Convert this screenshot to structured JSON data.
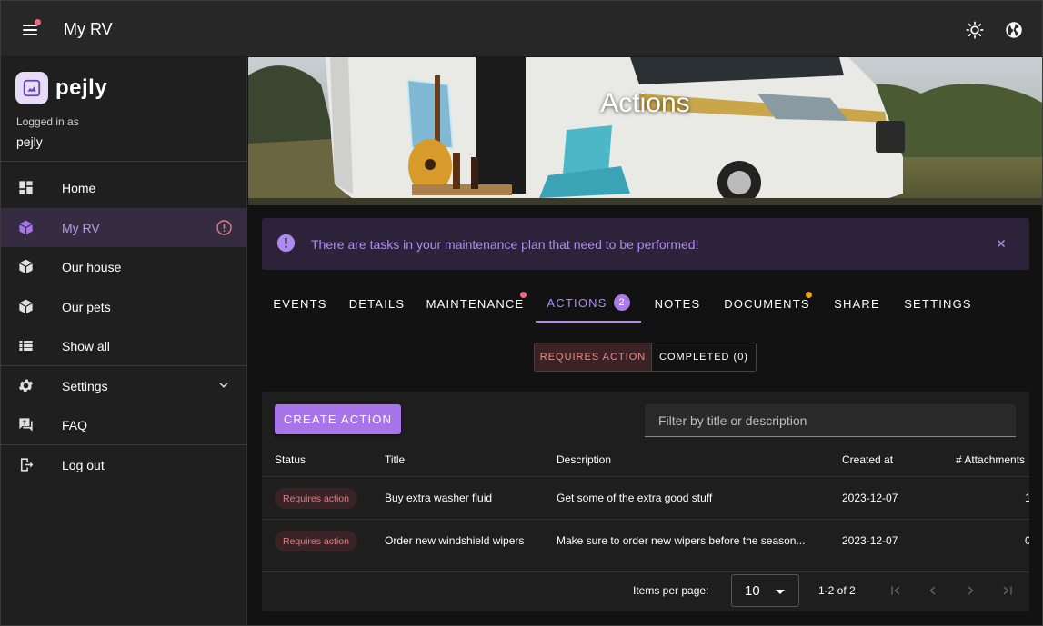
{
  "app": {
    "title": "My RV"
  },
  "brand": {
    "name": "pejly",
    "logged_in_label": "Logged in as",
    "username": "pejly"
  },
  "sidebar": {
    "items": [
      {
        "label": "Home",
        "icon": "dashboard-icon"
      },
      {
        "label": "My RV",
        "icon": "cube-icon",
        "active": true
      },
      {
        "label": "Our house",
        "icon": "cube-icon"
      },
      {
        "label": "Our pets",
        "icon": "cube-icon"
      },
      {
        "label": "Show all",
        "icon": "list-icon"
      },
      {
        "label": "Settings",
        "icon": "gear-icon"
      },
      {
        "label": "FAQ",
        "icon": "forum-icon"
      },
      {
        "label": "Log out",
        "icon": "logout-icon"
      }
    ]
  },
  "hero": {
    "title": "Actions"
  },
  "alert": {
    "text": "There are tasks in your maintenance plan that need to be performed!"
  },
  "tabs": [
    {
      "label": "EVENTS"
    },
    {
      "label": "DETAILS"
    },
    {
      "label": "MAINTENANCE"
    },
    {
      "label": "ACTIONS",
      "badge": "2",
      "active": true
    },
    {
      "label": "NOTES"
    },
    {
      "label": "DOCUMENTS"
    },
    {
      "label": "SHARE"
    },
    {
      "label": "SETTINGS"
    }
  ],
  "toggle": {
    "requires_action": "REQUIRES ACTION",
    "completed": "COMPLETED (0)"
  },
  "actions": {
    "create_label": "CREATE ACTION",
    "filter_placeholder": "Filter by title or description",
    "columns": {
      "status": "Status",
      "title": "Title",
      "description": "Description",
      "created": "Created at",
      "attachments": "# Attachments"
    },
    "rows": [
      {
        "status": "Requires action",
        "title": "Buy extra washer fluid",
        "description": "Get some of the extra good stuff",
        "created": "2023-12-07",
        "attachments": "1"
      },
      {
        "status": "Requires action",
        "title": "Order new windshield wipers",
        "description": "Make sure to order new wipers before the season...",
        "created": "2023-12-07",
        "attachments": "0"
      }
    ]
  },
  "pager": {
    "label": "Items per page:",
    "per_page": "10",
    "range": "1-2 of 2"
  },
  "colors": {
    "accent": "#a874ea",
    "alert_bg": "#2c2239",
    "status_chip": "#e07d85"
  }
}
